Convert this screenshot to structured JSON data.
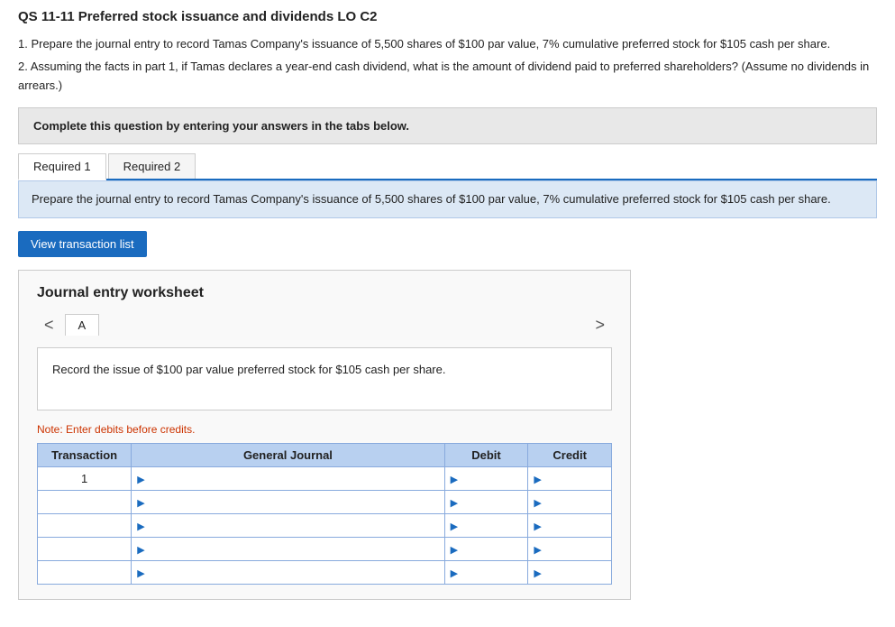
{
  "page": {
    "title": "QS 11-11 Preferred stock issuance and dividends LO C2"
  },
  "instructions": {
    "part1": "1. Prepare the journal entry to record Tamas Company's issuance of 5,500 shares of $100 par value, 7% cumulative preferred stock for $105 cash per share.",
    "part2": "2. Assuming the facts in part 1, if Tamas declares a year-end cash dividend, what is the amount of dividend paid to preferred shareholders? (Assume no dividends in arrears.)"
  },
  "complete_box": {
    "text": "Complete this question by entering your answers in the tabs below."
  },
  "tabs": [
    {
      "label": "Required 1",
      "active": true
    },
    {
      "label": "Required 2",
      "active": false
    }
  ],
  "tab_content": "Prepare the journal entry to record Tamas Company's issuance of 5,500 shares of $100 par value, 7% cumulative preferred stock for $105 cash per share.",
  "button": {
    "view_transaction": "View transaction list"
  },
  "worksheet": {
    "title": "Journal entry worksheet",
    "nav_left": "<",
    "nav_right": ">",
    "tab_label": "A",
    "record_text": "Record the issue of $100 par value preferred stock for $105 cash per share.",
    "note": "Note: Enter debits before credits.",
    "table": {
      "headers": [
        "Transaction",
        "General Journal",
        "Debit",
        "Credit"
      ],
      "rows": [
        {
          "transaction": "1",
          "general_journal": "",
          "debit": "",
          "credit": ""
        },
        {
          "transaction": "",
          "general_journal": "",
          "debit": "",
          "credit": ""
        },
        {
          "transaction": "",
          "general_journal": "",
          "debit": "",
          "credit": ""
        },
        {
          "transaction": "",
          "general_journal": "",
          "debit": "",
          "credit": ""
        },
        {
          "transaction": "",
          "general_journal": "",
          "debit": "",
          "credit": ""
        }
      ]
    }
  }
}
